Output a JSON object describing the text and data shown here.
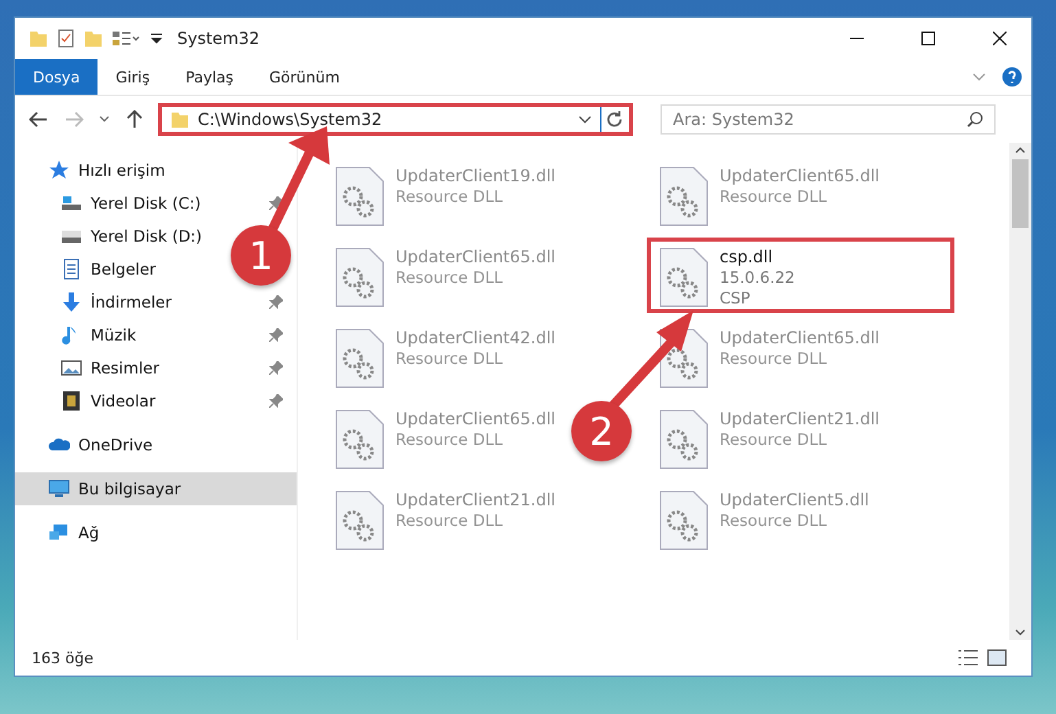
{
  "window": {
    "title": "System32"
  },
  "ribbon": {
    "tabs": [
      {
        "label": "Dosya",
        "selected": true
      },
      {
        "label": "Giriş",
        "selected": false
      },
      {
        "label": "Paylaş",
        "selected": false
      },
      {
        "label": "Görünüm",
        "selected": false
      }
    ]
  },
  "address_bar": {
    "path": "C:\\Windows\\System32",
    "highlighted": true
  },
  "search": {
    "placeholder": "Ara: System32"
  },
  "sidebar": {
    "items": [
      {
        "label": "Hızlı erişim",
        "kind": "star",
        "selected": false,
        "children": [
          {
            "label": "Yerel Disk (C:)",
            "kind": "drive-c",
            "pinned": true
          },
          {
            "label": "Yerel Disk (D:)",
            "kind": "drive",
            "pinned": false
          },
          {
            "label": "Belgeler",
            "kind": "docs",
            "pinned": false
          },
          {
            "label": "İndirmeler",
            "kind": "download",
            "pinned": true
          },
          {
            "label": "Müzik",
            "kind": "music",
            "pinned": true
          },
          {
            "label": "Resimler",
            "kind": "pictures",
            "pinned": true
          },
          {
            "label": "Videolar",
            "kind": "video",
            "pinned": true
          }
        ]
      },
      {
        "label": "OneDrive",
        "kind": "cloud",
        "selected": false
      },
      {
        "label": "Bu bilgisayar",
        "kind": "pc",
        "selected": true
      },
      {
        "label": "Ağ",
        "kind": "network",
        "selected": false
      }
    ]
  },
  "files": [
    {
      "name": "UpdaterClient19.dll",
      "description": "Resource DLL",
      "highlighted": false
    },
    {
      "name": "UpdaterClient65.dll",
      "description": "Resource DLL",
      "highlighted": false
    },
    {
      "name": "UpdaterClient65.dll",
      "description": "Resource DLL",
      "highlighted": false
    },
    {
      "name": "csp.dll",
      "version": "15.0.6.22",
      "description": "CSP",
      "highlighted": true
    },
    {
      "name": "UpdaterClient42.dll",
      "description": "Resource DLL",
      "highlighted": false
    },
    {
      "name": "UpdaterClient65.dll",
      "description": "Resource DLL",
      "highlighted": false
    },
    {
      "name": "UpdaterClient65.dll",
      "description": "Resource DLL",
      "highlighted": false
    },
    {
      "name": "UpdaterClient21.dll",
      "description": "Resource DLL",
      "highlighted": false
    },
    {
      "name": "UpdaterClient21.dll",
      "description": "Resource DLL",
      "highlighted": false
    },
    {
      "name": "UpdaterClient5.dll",
      "description": "Resource DLL",
      "highlighted": false
    }
  ],
  "status_bar": {
    "count": "163 öğe"
  },
  "annotations": [
    {
      "number": "1"
    },
    {
      "number": "2"
    }
  ]
}
